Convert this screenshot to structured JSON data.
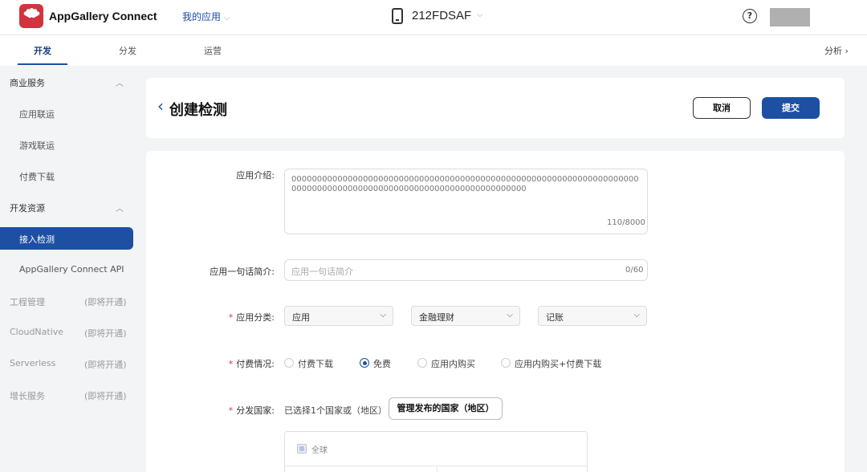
{
  "header": {
    "brand": "AppGallery Connect",
    "my_app": "我的应用",
    "device": "212FDSAF"
  },
  "nav": {
    "tabs": [
      "开发",
      "分发",
      "运营"
    ],
    "right": "分析 ›"
  },
  "sidebar": {
    "groups": [
      {
        "label": "商业服务",
        "items": [
          "应用联运",
          "游戏联运",
          "付费下载"
        ]
      },
      {
        "label": "开发资源",
        "items": [
          "接入检测",
          "AppGallery Connect API"
        ]
      }
    ],
    "soon_items": [
      {
        "label": "工程管理",
        "note": "(即将开通)"
      },
      {
        "label": "CloudNative",
        "note": "(即将开通)"
      },
      {
        "label": "Serverless",
        "note": "(即将开通)"
      },
      {
        "label": "增长服务",
        "note": "(即将开通)"
      }
    ]
  },
  "page": {
    "title": "创建检测",
    "cancel": "取消",
    "submit": "提交"
  },
  "form": {
    "intro_label": "应用介绍:",
    "intro_value": "000000000000000000000000000000000000000000000000000000000000000000000000000000000000000000000000000000000000000000",
    "intro_count": "110/8000",
    "oneline_label": "应用一句话简介:",
    "oneline_placeholder": "应用一句话简介",
    "oneline_count": "0/60",
    "category_label": "应用分类:",
    "categories": [
      "应用",
      "金融理财",
      "记账"
    ],
    "payment_label": "付费情况:",
    "payment_options": [
      "付费下载",
      "免费",
      "应用内购买",
      "应用内购买+付费下载"
    ],
    "payment_selected": "免费",
    "country_label": "分发国家:",
    "country_text": "已选择1个国家或（地区）",
    "country_button": "管理发布的国家（地区）",
    "global_label": "全球"
  }
}
